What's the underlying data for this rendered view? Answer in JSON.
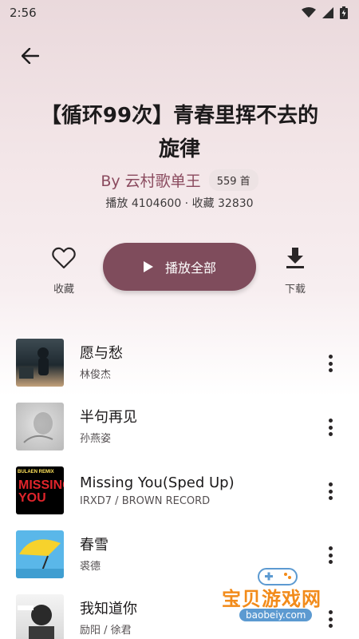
{
  "status_bar": {
    "time": "2:56"
  },
  "playlist": {
    "title": "【循环99次】青春里挥不去的旋律",
    "author": "By 云村歌单王",
    "song_count": "559 首",
    "stats": "播放 4104600 · 收藏 32830"
  },
  "actions": {
    "favorite_label": "收藏",
    "play_all_label": "播放全部",
    "download_label": "下载"
  },
  "songs": [
    {
      "title": "愿与愁",
      "artist": "林俊杰"
    },
    {
      "title": "半句再见",
      "artist": "孙燕姿"
    },
    {
      "title": "Missing You(Sped Up)",
      "artist": "IRXD7 / BROWN RECORD",
      "cover_text_top": "BULAEN REMIX",
      "cover_text_main": "MISSING YOU"
    },
    {
      "title": "春雪",
      "artist": "裘德"
    },
    {
      "title": "我知道你",
      "artist": "励阳 / 徐君"
    }
  ],
  "watermark": {
    "name": "宝贝游戏网",
    "url": "baobeiy.com"
  },
  "colors": {
    "accent": "#7f4c5c",
    "author": "#8a4a5e"
  },
  "icons": [
    "back-arrow-icon",
    "heart-icon",
    "play-icon",
    "download-icon",
    "more-vert-icon",
    "wifi-icon",
    "signal-icon",
    "battery-icon"
  ]
}
